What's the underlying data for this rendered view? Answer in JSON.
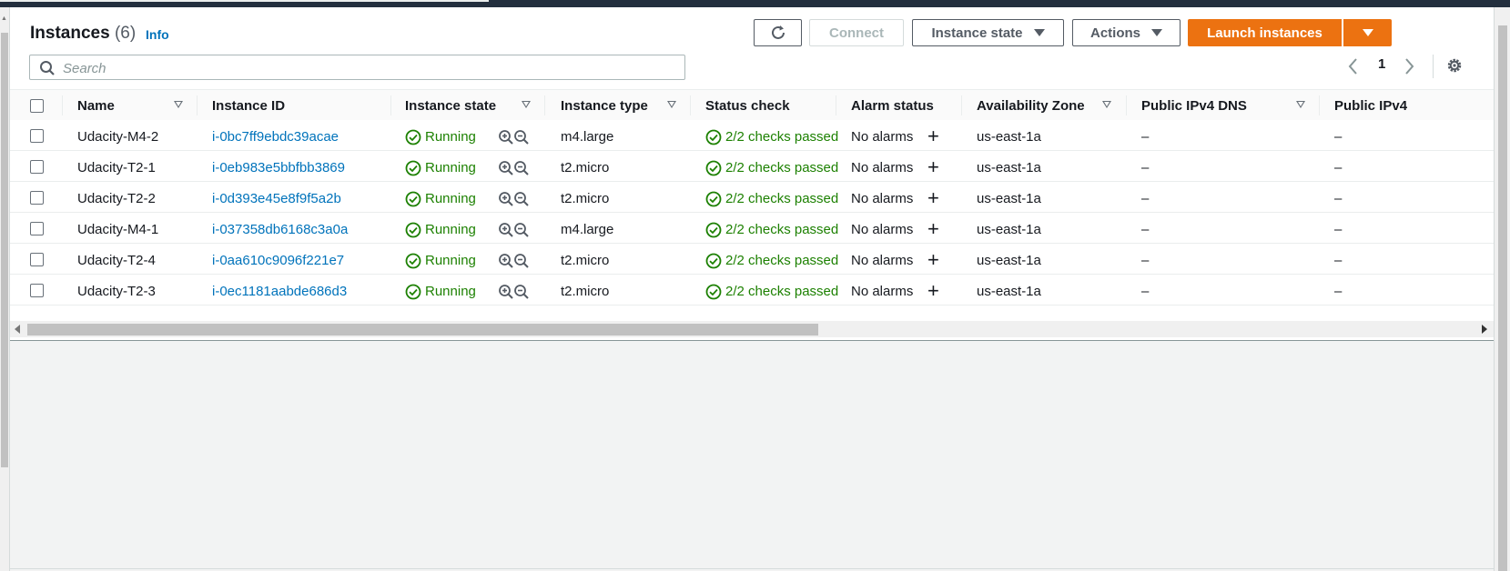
{
  "header": {
    "title": "Instances",
    "count": "(6)",
    "info_label": "Info"
  },
  "toolbar": {
    "connect_label": "Connect",
    "instance_state_label": "Instance state",
    "actions_label": "Actions",
    "launch_label": "Launch instances"
  },
  "search": {
    "placeholder": "Search"
  },
  "pagination": {
    "current_page": "1"
  },
  "columns": [
    "Name",
    "Instance ID",
    "Instance state",
    "Instance type",
    "Status check",
    "Alarm status",
    "Availability Zone",
    "Public IPv4 DNS",
    "Public IPv4"
  ],
  "rows": [
    {
      "name": "Udacity-M4-2",
      "id": "i-0bc7ff9ebdc39acae",
      "state": "Running",
      "type": "m4.large",
      "status": "2/2 checks passed",
      "alarm": "No alarms",
      "az": "us-east-1a",
      "dns": "–",
      "ip": "–"
    },
    {
      "name": "Udacity-T2-1",
      "id": "i-0eb983e5bbfbb3869",
      "state": "Running",
      "type": "t2.micro",
      "status": "2/2 checks passed",
      "alarm": "No alarms",
      "az": "us-east-1a",
      "dns": "–",
      "ip": "–"
    },
    {
      "name": "Udacity-T2-2",
      "id": "i-0d393e45e8f9f5a2b",
      "state": "Running",
      "type": "t2.micro",
      "status": "2/2 checks passed",
      "alarm": "No alarms",
      "az": "us-east-1a",
      "dns": "–",
      "ip": "–"
    },
    {
      "name": "Udacity-M4-1",
      "id": "i-037358db6168c3a0a",
      "state": "Running",
      "type": "m4.large",
      "status": "2/2 checks passed",
      "alarm": "No alarms",
      "az": "us-east-1a",
      "dns": "–",
      "ip": "–"
    },
    {
      "name": "Udacity-T2-4",
      "id": "i-0aa610c9096f221e7",
      "state": "Running",
      "type": "t2.micro",
      "status": "2/2 checks passed",
      "alarm": "No alarms",
      "az": "us-east-1a",
      "dns": "–",
      "ip": "–"
    },
    {
      "name": "Udacity-T2-3",
      "id": "i-0ec1181aabde686d3",
      "state": "Running",
      "type": "t2.micro",
      "status": "2/2 checks passed",
      "alarm": "No alarms",
      "az": "us-east-1a",
      "dns": "–",
      "ip": "–"
    }
  ],
  "colors": {
    "primary": "#ec7211",
    "link": "#0073bb",
    "success": "#1d8102",
    "topbar": "#232f3e"
  },
  "icons": [
    "refresh-icon",
    "search-icon",
    "chevron-left-icon",
    "chevron-right-icon",
    "settings-gear-icon",
    "check-circle-icon",
    "zoom-in-icon",
    "zoom-out-icon",
    "plus-icon",
    "sort-caret-icon"
  ]
}
